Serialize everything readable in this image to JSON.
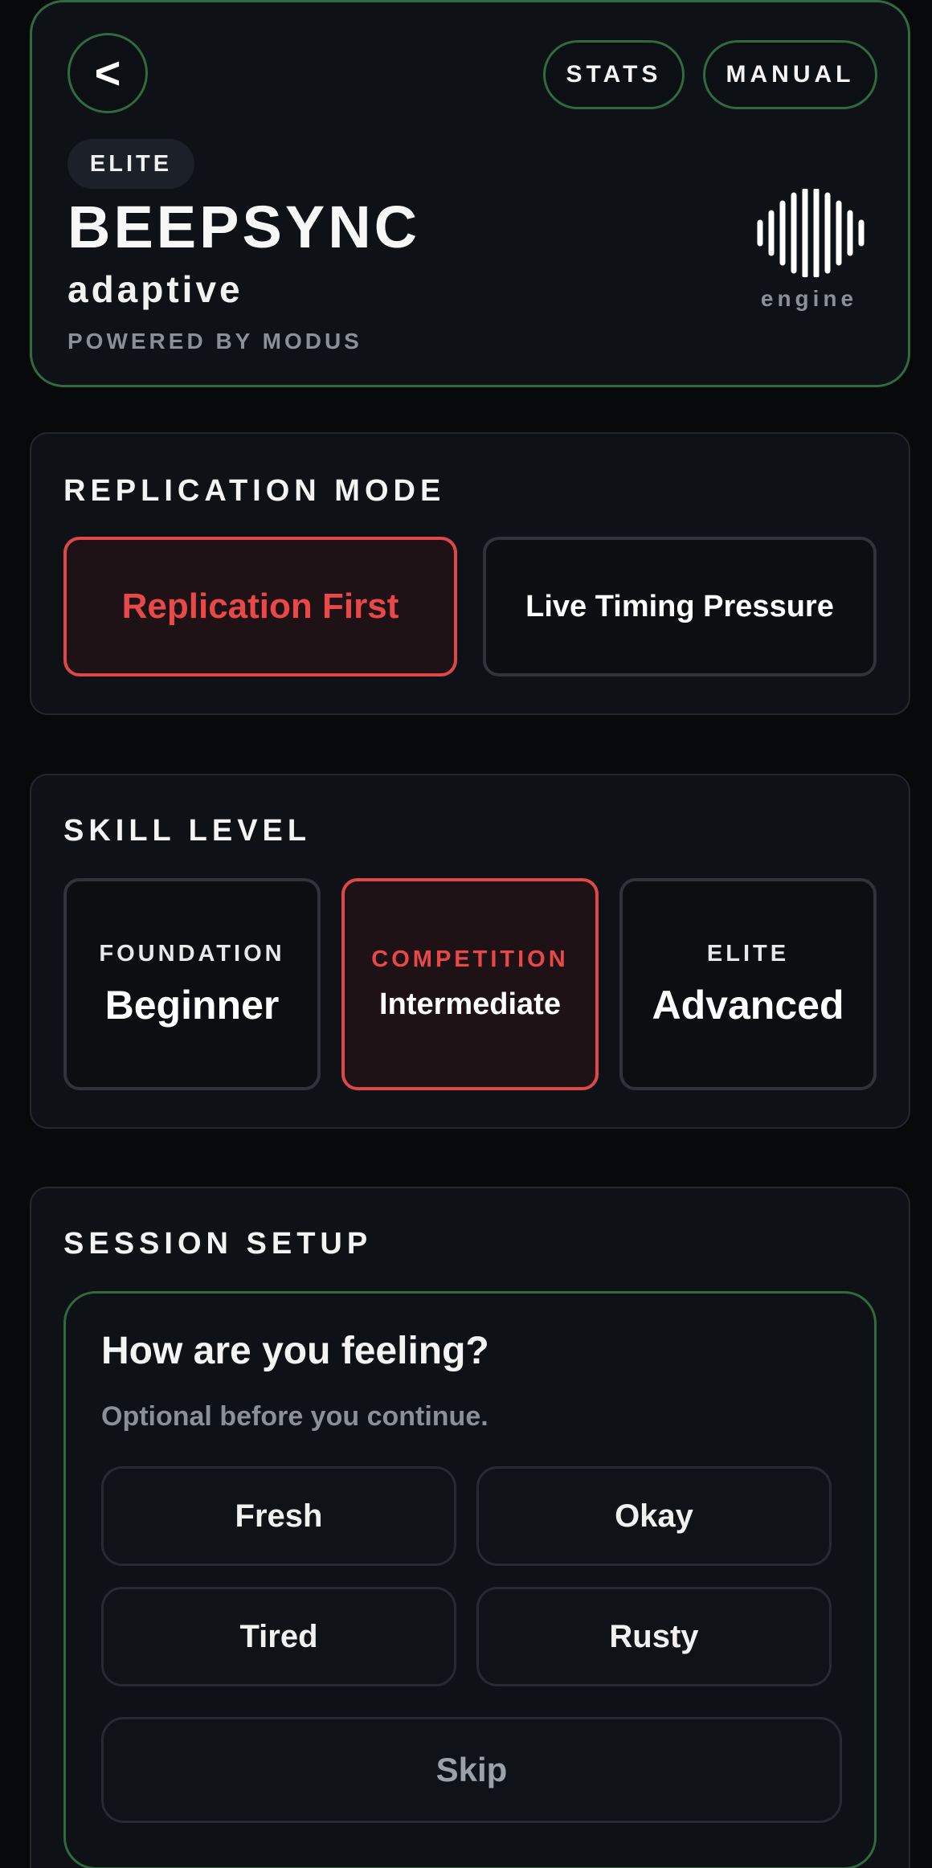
{
  "header": {
    "back_label": "<",
    "stats_label": "STATS",
    "manual_label": "MANUAL",
    "tier_badge": "ELITE",
    "title": "BEEPSYNC",
    "subtitle": "adaptive",
    "powered_by": "POWERED BY MODUS",
    "engine_label": "engine",
    "engine_icon": "waveform-icon"
  },
  "replication_mode": {
    "title": "REPLICATION MODE",
    "options": [
      {
        "label": "Replication First",
        "selected": true
      },
      {
        "label": "Live Timing Pressure",
        "selected": false
      }
    ]
  },
  "skill_level": {
    "title": "SKILL LEVEL",
    "options": [
      {
        "tag": "FOUNDATION",
        "label": "Beginner",
        "selected": false
      },
      {
        "tag": "COMPETITION",
        "label": "Intermediate",
        "selected": true
      },
      {
        "tag": "ELITE",
        "label": "Advanced",
        "selected": false
      }
    ]
  },
  "session_setup": {
    "title": "SESSION SETUP",
    "question": "How are you feeling?",
    "hint": "Optional before you continue.",
    "moods": [
      "Fresh",
      "Okay",
      "Tired",
      "Rusty"
    ],
    "skip_label": "Skip"
  },
  "colors": {
    "accent_green": "#2f6b3e",
    "accent_red": "#e84848",
    "background": "#08090b",
    "card": "#0e1116"
  }
}
